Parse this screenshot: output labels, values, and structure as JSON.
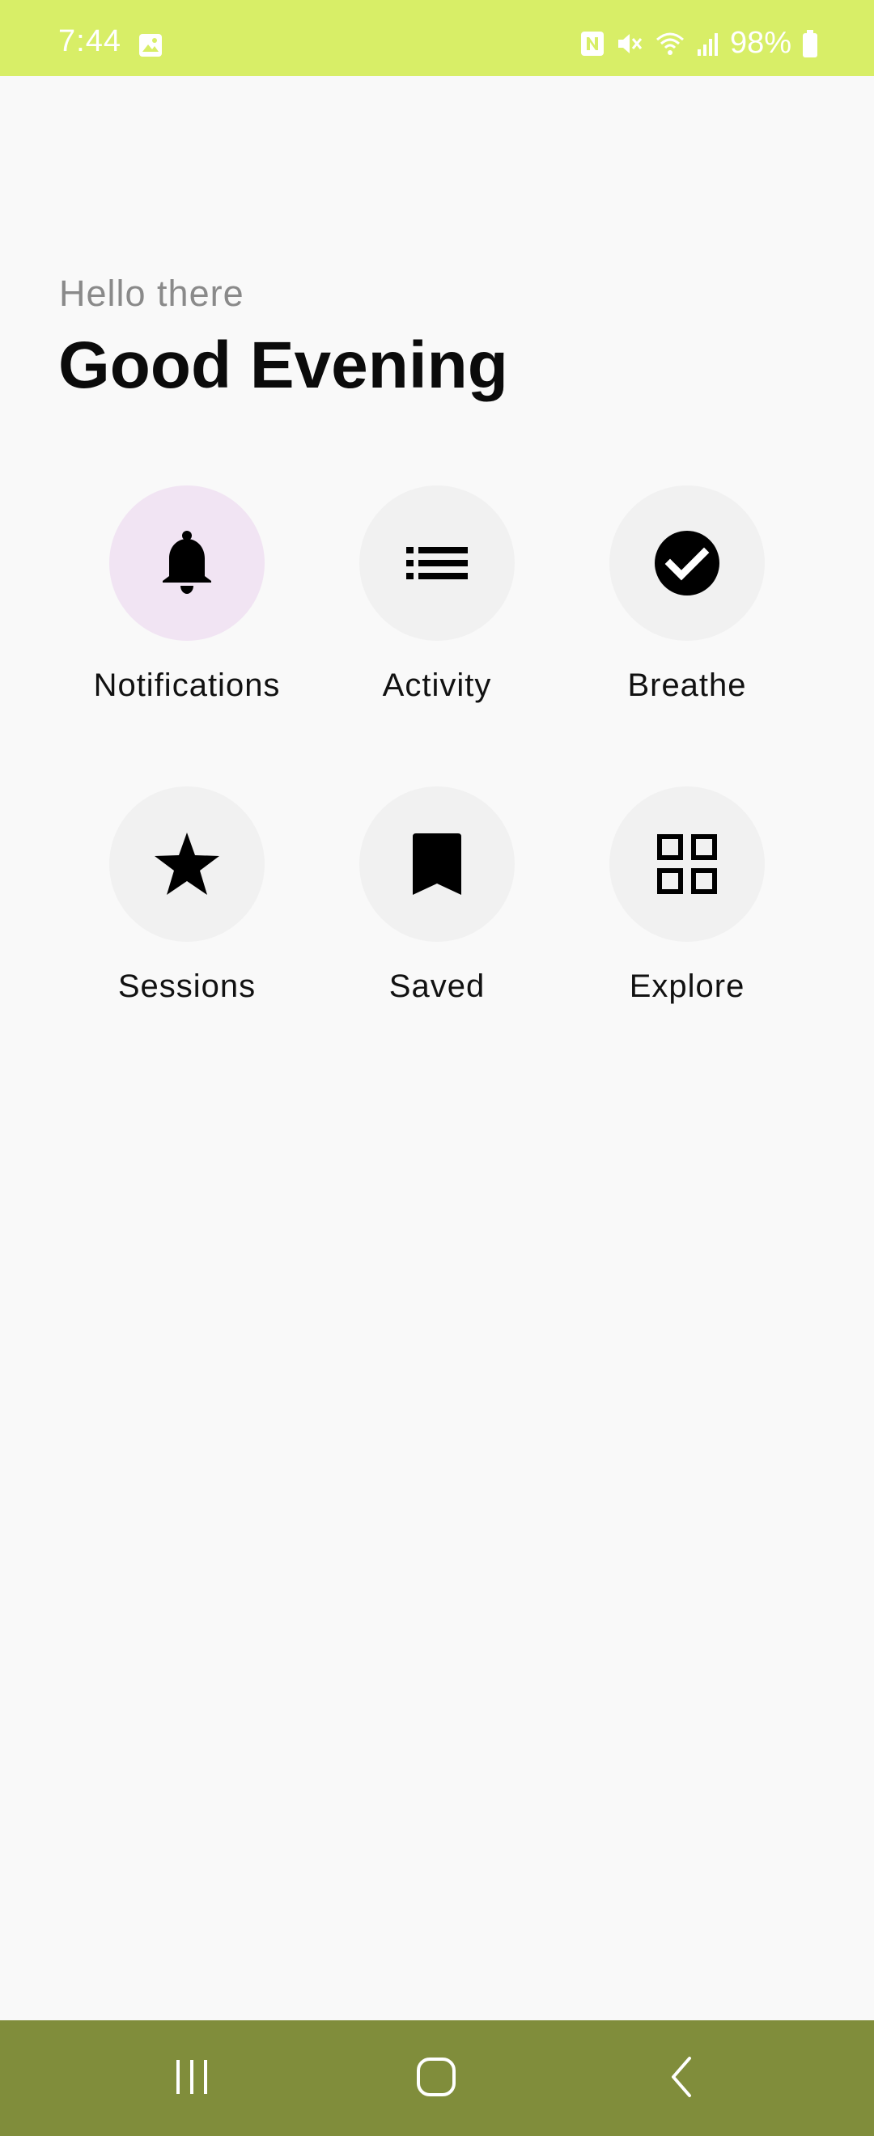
{
  "status_bar": {
    "time": "7:44",
    "battery": "98%",
    "background": "#d8ee67",
    "icons": [
      "gallery-icon",
      "nfc-icon",
      "mute-icon",
      "wifi-icon",
      "signal-icon",
      "battery-icon"
    ]
  },
  "header": {
    "subtitle": "Hello there",
    "title": "Good Evening"
  },
  "grid": {
    "items": [
      {
        "label": "Notifications",
        "icon": "bell-icon",
        "active": true
      },
      {
        "label": "Activity",
        "icon": "list-icon",
        "active": false
      },
      {
        "label": "Breathe",
        "icon": "check-circle-icon",
        "active": false
      },
      {
        "label": "Sessions",
        "icon": "star-icon",
        "active": false
      },
      {
        "label": "Saved",
        "icon": "bookmark-icon",
        "active": false
      },
      {
        "label": "Explore",
        "icon": "grid-icon",
        "active": false
      }
    ],
    "active_color": "#f1e4f3",
    "inactive_color": "#f1f1f1"
  },
  "nav_bar": {
    "background": "#808d3b",
    "buttons": [
      "recents-icon",
      "home-icon",
      "back-icon"
    ]
  }
}
